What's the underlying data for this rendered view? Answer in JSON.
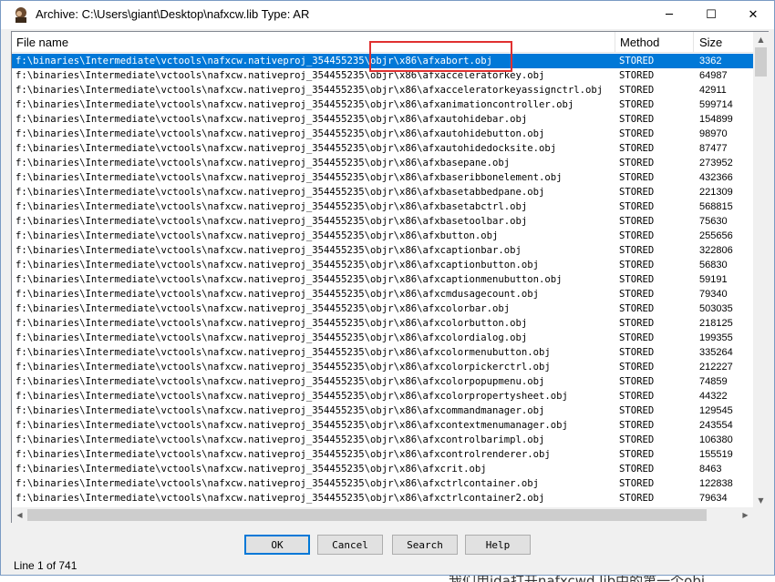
{
  "window": {
    "title": "Archive: C:\\Users\\giant\\Desktop\\nafxcw.lib Type: AR",
    "min_glyph": "─",
    "max_glyph": "☐",
    "close_glyph": "✕",
    "icon": "archive-app-icon"
  },
  "list": {
    "columns": {
      "name": "File name",
      "method": "Method",
      "size": "Size"
    },
    "rows": [
      {
        "name": "f:\\binaries\\Intermediate\\vctools\\nafxcw.nativeproj_354455235\\objr\\x86\\afxabort.obj",
        "method": "STORED",
        "size": "3362"
      },
      {
        "name": "f:\\binaries\\Intermediate\\vctools\\nafxcw.nativeproj_354455235\\objr\\x86\\afxacceleratorkey.obj",
        "method": "STORED",
        "size": "64987"
      },
      {
        "name": "f:\\binaries\\Intermediate\\vctools\\nafxcw.nativeproj_354455235\\objr\\x86\\afxacceleratorkeyassignctrl.obj",
        "method": "STORED",
        "size": "42911"
      },
      {
        "name": "f:\\binaries\\Intermediate\\vctools\\nafxcw.nativeproj_354455235\\objr\\x86\\afxanimationcontroller.obj",
        "method": "STORED",
        "size": "599714"
      },
      {
        "name": "f:\\binaries\\Intermediate\\vctools\\nafxcw.nativeproj_354455235\\objr\\x86\\afxautohidebar.obj",
        "method": "STORED",
        "size": "154899"
      },
      {
        "name": "f:\\binaries\\Intermediate\\vctools\\nafxcw.nativeproj_354455235\\objr\\x86\\afxautohidebutton.obj",
        "method": "STORED",
        "size": "98970"
      },
      {
        "name": "f:\\binaries\\Intermediate\\vctools\\nafxcw.nativeproj_354455235\\objr\\x86\\afxautohidedocksite.obj",
        "method": "STORED",
        "size": "87477"
      },
      {
        "name": "f:\\binaries\\Intermediate\\vctools\\nafxcw.nativeproj_354455235\\objr\\x86\\afxbasepane.obj",
        "method": "STORED",
        "size": "273952"
      },
      {
        "name": "f:\\binaries\\Intermediate\\vctools\\nafxcw.nativeproj_354455235\\objr\\x86\\afxbaseribbonelement.obj",
        "method": "STORED",
        "size": "432366"
      },
      {
        "name": "f:\\binaries\\Intermediate\\vctools\\nafxcw.nativeproj_354455235\\objr\\x86\\afxbasetabbedpane.obj",
        "method": "STORED",
        "size": "221309"
      },
      {
        "name": "f:\\binaries\\Intermediate\\vctools\\nafxcw.nativeproj_354455235\\objr\\x86\\afxbasetabctrl.obj",
        "method": "STORED",
        "size": "568815"
      },
      {
        "name": "f:\\binaries\\Intermediate\\vctools\\nafxcw.nativeproj_354455235\\objr\\x86\\afxbasetoolbar.obj",
        "method": "STORED",
        "size": "75630"
      },
      {
        "name": "f:\\binaries\\Intermediate\\vctools\\nafxcw.nativeproj_354455235\\objr\\x86\\afxbutton.obj",
        "method": "STORED",
        "size": "255656"
      },
      {
        "name": "f:\\binaries\\Intermediate\\vctools\\nafxcw.nativeproj_354455235\\objr\\x86\\afxcaptionbar.obj",
        "method": "STORED",
        "size": "322806"
      },
      {
        "name": "f:\\binaries\\Intermediate\\vctools\\nafxcw.nativeproj_354455235\\objr\\x86\\afxcaptionbutton.obj",
        "method": "STORED",
        "size": "56830"
      },
      {
        "name": "f:\\binaries\\Intermediate\\vctools\\nafxcw.nativeproj_354455235\\objr\\x86\\afxcaptionmenubutton.obj",
        "method": "STORED",
        "size": "59191"
      },
      {
        "name": "f:\\binaries\\Intermediate\\vctools\\nafxcw.nativeproj_354455235\\objr\\x86\\afxcmdusagecount.obj",
        "method": "STORED",
        "size": "79340"
      },
      {
        "name": "f:\\binaries\\Intermediate\\vctools\\nafxcw.nativeproj_354455235\\objr\\x86\\afxcolorbar.obj",
        "method": "STORED",
        "size": "503035"
      },
      {
        "name": "f:\\binaries\\Intermediate\\vctools\\nafxcw.nativeproj_354455235\\objr\\x86\\afxcolorbutton.obj",
        "method": "STORED",
        "size": "218125"
      },
      {
        "name": "f:\\binaries\\Intermediate\\vctools\\nafxcw.nativeproj_354455235\\objr\\x86\\afxcolordialog.obj",
        "method": "STORED",
        "size": "199355"
      },
      {
        "name": "f:\\binaries\\Intermediate\\vctools\\nafxcw.nativeproj_354455235\\objr\\x86\\afxcolormenubutton.obj",
        "method": "STORED",
        "size": "335264"
      },
      {
        "name": "f:\\binaries\\Intermediate\\vctools\\nafxcw.nativeproj_354455235\\objr\\x86\\afxcolorpickerctrl.obj",
        "method": "STORED",
        "size": "212227"
      },
      {
        "name": "f:\\binaries\\Intermediate\\vctools\\nafxcw.nativeproj_354455235\\objr\\x86\\afxcolorpopupmenu.obj",
        "method": "STORED",
        "size": "74859"
      },
      {
        "name": "f:\\binaries\\Intermediate\\vctools\\nafxcw.nativeproj_354455235\\objr\\x86\\afxcolorpropertysheet.obj",
        "method": "STORED",
        "size": "44322"
      },
      {
        "name": "f:\\binaries\\Intermediate\\vctools\\nafxcw.nativeproj_354455235\\objr\\x86\\afxcommandmanager.obj",
        "method": "STORED",
        "size": "129545"
      },
      {
        "name": "f:\\binaries\\Intermediate\\vctools\\nafxcw.nativeproj_354455235\\objr\\x86\\afxcontextmenumanager.obj",
        "method": "STORED",
        "size": "243554"
      },
      {
        "name": "f:\\binaries\\Intermediate\\vctools\\nafxcw.nativeproj_354455235\\objr\\x86\\afxcontrolbarimpl.obj",
        "method": "STORED",
        "size": "106380"
      },
      {
        "name": "f:\\binaries\\Intermediate\\vctools\\nafxcw.nativeproj_354455235\\objr\\x86\\afxcontrolrenderer.obj",
        "method": "STORED",
        "size": "155519"
      },
      {
        "name": "f:\\binaries\\Intermediate\\vctools\\nafxcw.nativeproj_354455235\\objr\\x86\\afxcrit.obj",
        "method": "STORED",
        "size": "8463"
      },
      {
        "name": "f:\\binaries\\Intermediate\\vctools\\nafxcw.nativeproj_354455235\\objr\\x86\\afxctrlcontainer.obj",
        "method": "STORED",
        "size": "122838"
      },
      {
        "name": "f:\\binaries\\Intermediate\\vctools\\nafxcw.nativeproj_354455235\\objr\\x86\\afxctrlcontainer2.obj",
        "method": "STORED",
        "size": "79634"
      }
    ],
    "selected_index": 0
  },
  "buttons": {
    "ok": "OK",
    "cancel": "Cancel",
    "search": "Search",
    "help": "Help"
  },
  "status": "Line 1 of 741",
  "background": {
    "bottom_text": "我们用ida打开nafxcwd.lib中的第一个obj"
  },
  "colors": {
    "selection": "#0078d7",
    "highlight_box": "#e03030"
  }
}
